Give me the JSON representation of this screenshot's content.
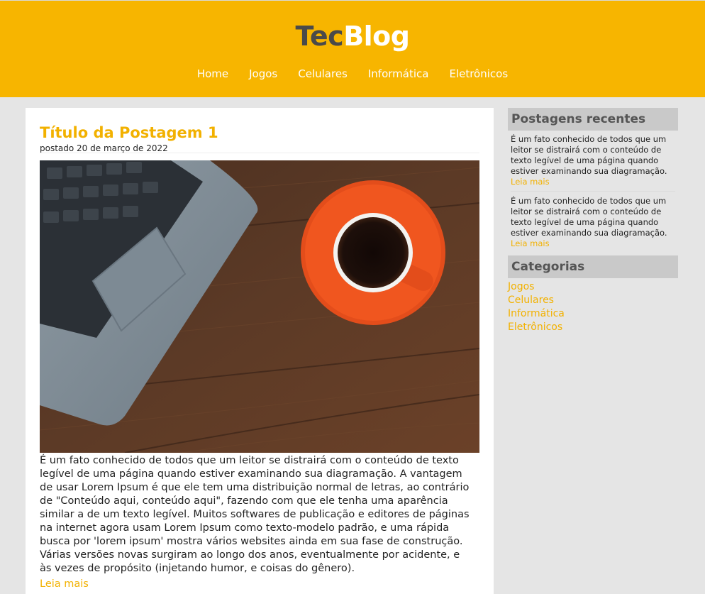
{
  "site": {
    "logo_part1": "Tec",
    "logo_part2": "Blog",
    "brand_color": "#f7b500",
    "nav": [
      "Home",
      "Jogos",
      "Celulares",
      "Informática",
      "Eletrônicos"
    ]
  },
  "post": {
    "title": "Título da Postagem 1",
    "date": "postado 20 de março de 2022",
    "body": "É um fato conhecido de todos que um leitor se distrairá com o conteúdo de texto legível de uma página quando estiver examinando sua diagramação. A vantagem de usar Lorem Ipsum é que ele tem uma distribuição normal de letras, ao contrário de \"Conteúdo aqui, conteúdo aqui\", fazendo com que ele tenha uma aparência similar a de um texto legível. Muitos softwares de publicação e editores de páginas na internet agora usam Lorem Ipsum como texto-modelo padrão, e uma rápida busca por 'lorem ipsum' mostra vários websites ainda em sua fase de construção. Várias versões novas surgiram ao longo dos anos, eventualmente por acidente, e às vezes de propósito (injetando humor, e coisas do gênero).",
    "more": "Leia mais"
  },
  "sidebar": {
    "recent_title": "Postagens recentes",
    "recent": [
      {
        "text": "É um fato conhecido de todos que um leitor se distrairá com o conteúdo de texto legível de uma página quando estiver examinando sua diagramação.",
        "more": "Leia mais"
      },
      {
        "text": "É um fato conhecido de todos que um leitor se distrairá com o conteúdo de texto legível de uma página quando estiver examinando sua diagramação.",
        "more": "Leia mais"
      }
    ],
    "categories_title": "Categorias",
    "categories": [
      "Jogos",
      "Celulares",
      "Informática",
      "Eletrônicos"
    ]
  }
}
